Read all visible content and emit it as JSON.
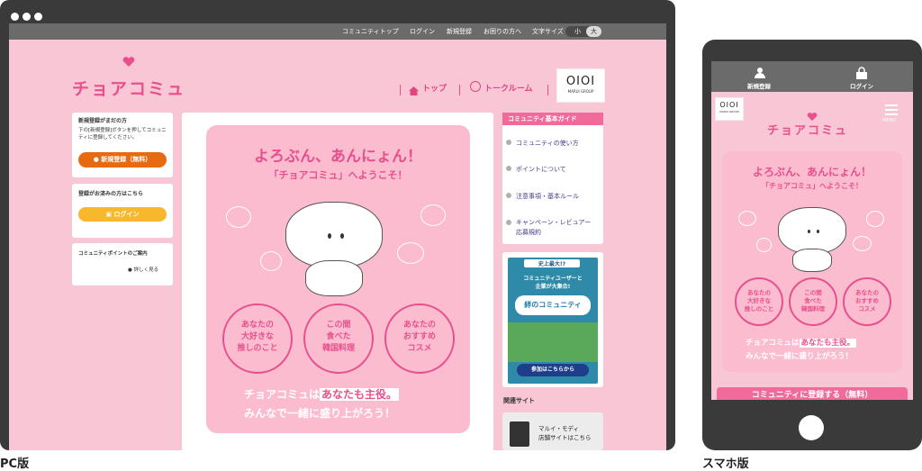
{
  "pc": {
    "nav": [
      "コミュニティトップ",
      "ログイン",
      "新規登録",
      "お困りの方へ",
      "文字サイズ"
    ],
    "size_small": "小",
    "size_large": "大",
    "logo": "チョアコミュ",
    "link_top": "トップ",
    "link_talk": "トークルーム",
    "oioi_logo": "OIOI",
    "oioi_sub": "MARUI GROUP",
    "signup_title": "新規登録がまだの方",
    "signup_desc": "下の[新規登録]ボタンを押してコミュニティに登録してください。",
    "signup_button": "新規登録（無料）",
    "login_title": "登録がお済みの方はこちら",
    "login_button": "ログイン",
    "points_title": "コミュニティポイントのご案内",
    "points_link": "詳しく見る",
    "hero_title1": "よろぶん、あんにょん！",
    "hero_title2": "「チョアコミュ」へようこそ！",
    "circles": [
      {
        "l1": "あなたの",
        "l2": "大好きな",
        "l3": "推しのこと"
      },
      {
        "l1": "この間",
        "l2": "食べた",
        "l3": "韓国料理"
      },
      {
        "l1": "あなたの",
        "l2": "おすすめ",
        "l3": "コスメ"
      }
    ],
    "tag_pre": "チョアコミュは",
    "tag_hl": "あなたも主役。",
    "tag_line2": "みんなで一緒に盛り上がろう！",
    "guide_title": "コミュニティ基本ガイド",
    "guide_items": [
      "コミュニティの使い方",
      "ポイントについて",
      "注意事項・基本ルール",
      "キャンペーン・レビュアー",
      "応募規約"
    ],
    "banner_top": "史上最大!?",
    "banner_line1": "コミュニティユーザーと",
    "banner_line2": "企業が大集合!",
    "banner_main": "絆のコミュニティ",
    "banner_button": "参加はこちらから",
    "related_title": "関連サイト",
    "related_line1": "マルイ・モディ",
    "related_line2": "店舗サイトはこちら"
  },
  "phone": {
    "signup": "新規登録",
    "login": "ログイン",
    "menu": "MENU",
    "oioi_logo": "OIOI",
    "oioi_sub": "MARUI GROUP",
    "logo": "チョアコミュ",
    "hero_title1": "よろぶん、あんにょん！",
    "hero_title2": "「チョアコミュ」へようこそ！",
    "circles": [
      {
        "l1": "あなたの",
        "l2": "大好きな",
        "l3": "推しのこと"
      },
      {
        "l1": "この間",
        "l2": "食べた",
        "l3": "韓国料理"
      },
      {
        "l1": "あなたの",
        "l2": "おすすめ",
        "l3": "コスメ"
      }
    ],
    "tag_pre": "チョアコミュは",
    "tag_hl": "あなたも主役。",
    "tag_line2": "みんなで一緒に盛り上がろう！",
    "register_button": "コミュニティに登録する（無料）"
  },
  "labels": {
    "pc": "PC版",
    "sp": "スマホ版"
  },
  "colors": {
    "pink_bg": "#f9c6d6",
    "accent": "#e8508c",
    "orange": "#e76a10",
    "yellow": "#f7b82c",
    "nav_gray": "#6b6b6b",
    "frame": "#3a3a3a"
  }
}
